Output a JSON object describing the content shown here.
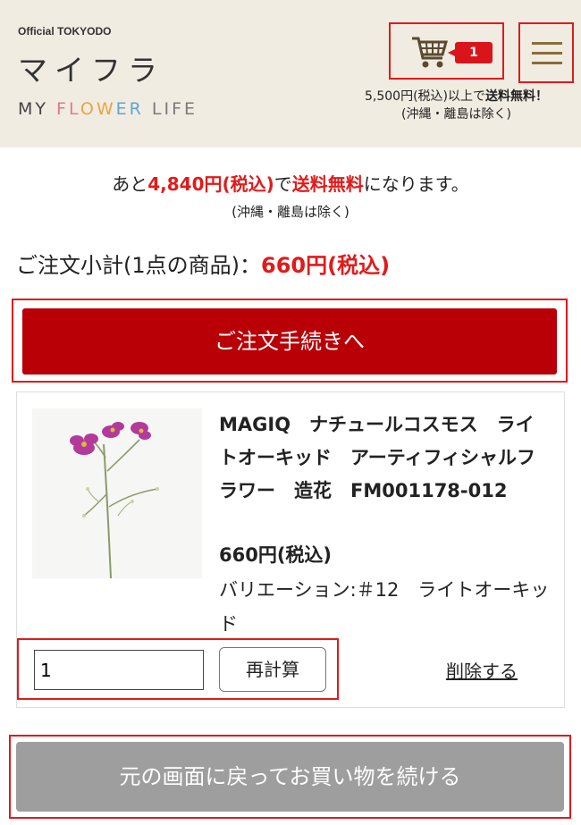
{
  "header": {
    "brand_small": "Official TOKYODO",
    "brand_jp": "マイフラ",
    "brand_en_parts": [
      "MY ",
      "FL",
      "OW",
      "ER",
      " LIFE"
    ],
    "cart_count": "1",
    "ship_note_line1_prefix": "5,500円(税込)以上で",
    "ship_note_line1_bold": "送料無料！",
    "ship_note_line2": "(沖縄・離島は除く)"
  },
  "summary": {
    "remain_prefix": "あと",
    "remain_amount": "4,840円(税込)",
    "remain_mid": "で",
    "remain_free": "送料無料",
    "remain_suffix": "になります。",
    "remain_sub": "(沖縄・離島は除く)",
    "subtotal_label": "ご注文小計(1点の商品)：",
    "subtotal_value": "660円(税込)"
  },
  "checkout": {
    "label": "ご注文手続きへ"
  },
  "item": {
    "title": "MAGIQ　ナチュールコスモス　ライトオーキッド　アーティフィシャルフラワー　造花　FM001178-012",
    "price": "660円(税込)",
    "variation": "バリエーション:＃12　ライトオーキッド",
    "quantity": "1",
    "recalc_label": "再計算",
    "delete_label": "削除する"
  },
  "back": {
    "label": "元の画面に戻ってお買い物を続ける"
  },
  "colors": {
    "accent_red": "#e01b1b",
    "checkout_bg": "#b90006",
    "header_bg": "#f1ece2",
    "back_bg": "#9e9e9e"
  },
  "icons": [
    "cart-icon",
    "hamburger-menu-icon"
  ]
}
